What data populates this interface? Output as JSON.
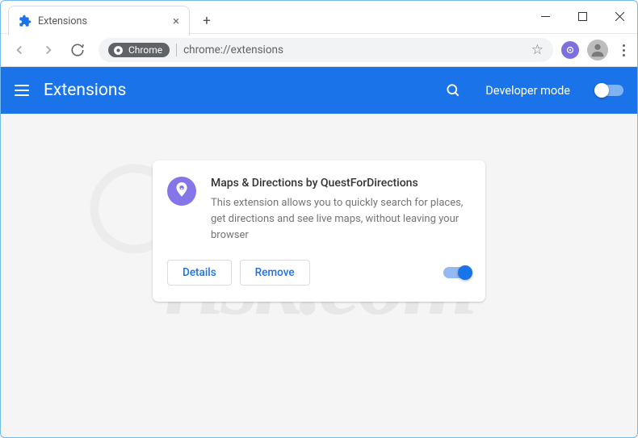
{
  "window": {
    "tab_title": "Extensions"
  },
  "toolbar": {
    "chrome_label": "Chrome",
    "url": "chrome://extensions"
  },
  "header": {
    "title": "Extensions",
    "dev_mode_label": "Developer mode"
  },
  "card": {
    "title": "Maps & Directions by QuestForDirections",
    "description": "This extension allows you to quickly search for places, get directions and see live maps, without leaving your browser",
    "details_label": "Details",
    "remove_label": "Remove"
  },
  "watermark": {
    "text": "risk.com"
  }
}
